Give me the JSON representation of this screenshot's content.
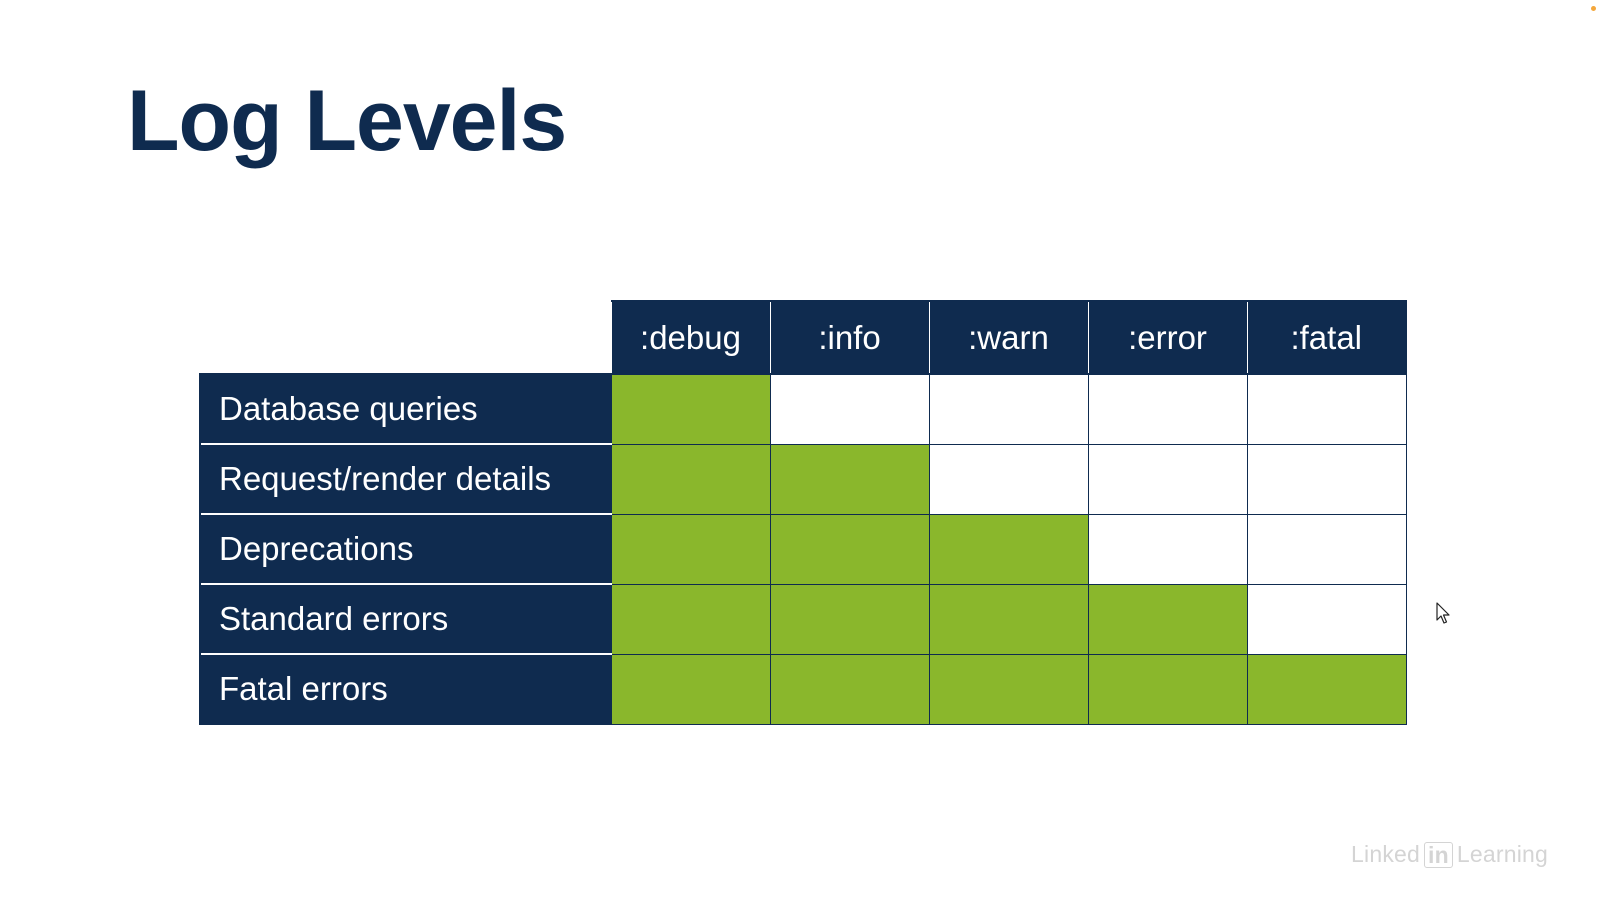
{
  "slide": {
    "title": "Log Levels"
  },
  "table": {
    "levels": [
      ":debug",
      ":info",
      ":warn",
      ":error",
      ":fatal"
    ],
    "rows": [
      {
        "label": "Database queries",
        "enabled": [
          true,
          false,
          false,
          false,
          false
        ]
      },
      {
        "label": "Request/render details",
        "enabled": [
          true,
          true,
          false,
          false,
          false
        ]
      },
      {
        "label": "Deprecations",
        "enabled": [
          true,
          true,
          true,
          false,
          false
        ]
      },
      {
        "label": "Standard errors",
        "enabled": [
          true,
          true,
          true,
          true,
          false
        ]
      },
      {
        "label": "Fatal errors",
        "enabled": [
          true,
          true,
          true,
          true,
          true
        ]
      }
    ]
  },
  "branding": {
    "prefix": "Linked",
    "in": "in",
    "suffix": "Learning"
  },
  "colors": {
    "header_navy": "#0f2b4f",
    "enabled_green": "#8ab72c",
    "disabled_white": "#ffffff"
  }
}
